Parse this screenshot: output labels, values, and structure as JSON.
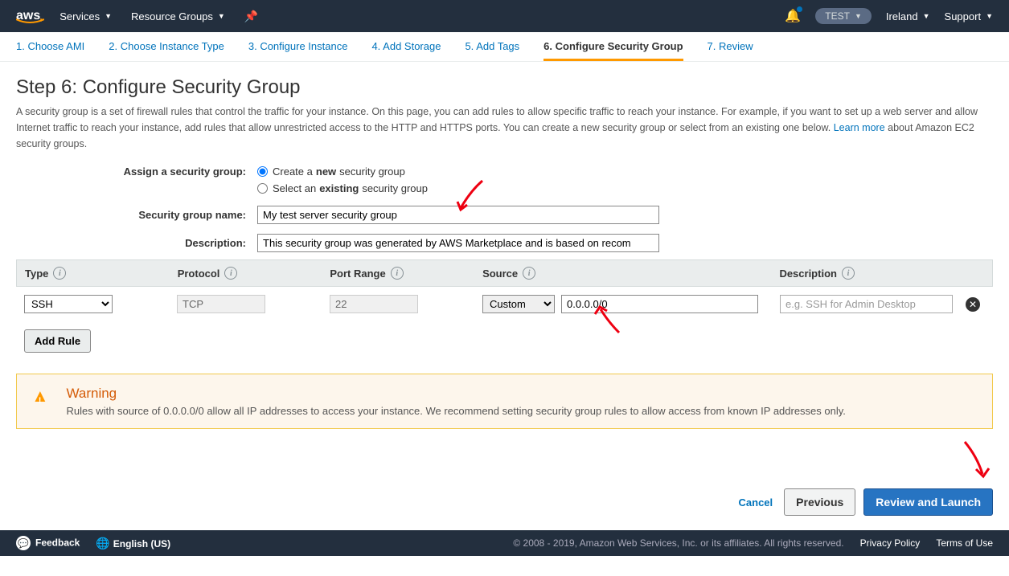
{
  "topnav": {
    "services": "Services",
    "resource_groups": "Resource Groups",
    "account": "TEST",
    "region": "Ireland",
    "support": "Support"
  },
  "wizard": {
    "tabs": [
      "1. Choose AMI",
      "2. Choose Instance Type",
      "3. Configure Instance",
      "4. Add Storage",
      "5. Add Tags",
      "6. Configure Security Group",
      "7. Review"
    ],
    "active_index": 5
  },
  "page": {
    "title": "Step 6: Configure Security Group",
    "desc_pre": "A security group is a set of firewall rules that control the traffic for your instance. On this page, you can add rules to allow specific traffic to reach your instance. For example, if you want to set up a web server and allow Internet traffic to reach your instance, add rules that allow unrestricted access to the HTTP and HTTPS ports. You can create a new security group or select from an existing one below. ",
    "learn_more": "Learn more",
    "desc_post": " about Amazon EC2 security groups."
  },
  "form": {
    "assign_label": "Assign a security group:",
    "opt_create_pre": "Create a ",
    "opt_create_bold": "new",
    "opt_create_post": " security group",
    "opt_select_pre": "Select an ",
    "opt_select_bold": "existing",
    "opt_select_post": " security group",
    "name_label": "Security group name:",
    "name_value": "My test server security group",
    "desc_label": "Description:",
    "desc_value": "This security group was generated by AWS Marketplace and is based on recom"
  },
  "table": {
    "headers": {
      "type": "Type",
      "protocol": "Protocol",
      "port_range": "Port Range",
      "source": "Source",
      "description": "Description"
    },
    "rows": [
      {
        "type": "SSH",
        "protocol": "TCP",
        "port_range": "22",
        "source_mode": "Custom",
        "source_value": "0.0.0.0/0",
        "desc_placeholder": "e.g. SSH for Admin Desktop"
      }
    ],
    "add_rule": "Add Rule"
  },
  "warning": {
    "title": "Warning",
    "text": "Rules with source of 0.0.0.0/0 allow all IP addresses to access your instance. We recommend setting security group rules to allow access from known IP addresses only."
  },
  "buttons": {
    "cancel": "Cancel",
    "previous": "Previous",
    "review": "Review and Launch"
  },
  "footer": {
    "feedback": "Feedback",
    "language": "English (US)",
    "copyright": "© 2008 - 2019, Amazon Web Services, Inc. or its affiliates. All rights reserved.",
    "privacy": "Privacy Policy",
    "terms": "Terms of Use"
  }
}
